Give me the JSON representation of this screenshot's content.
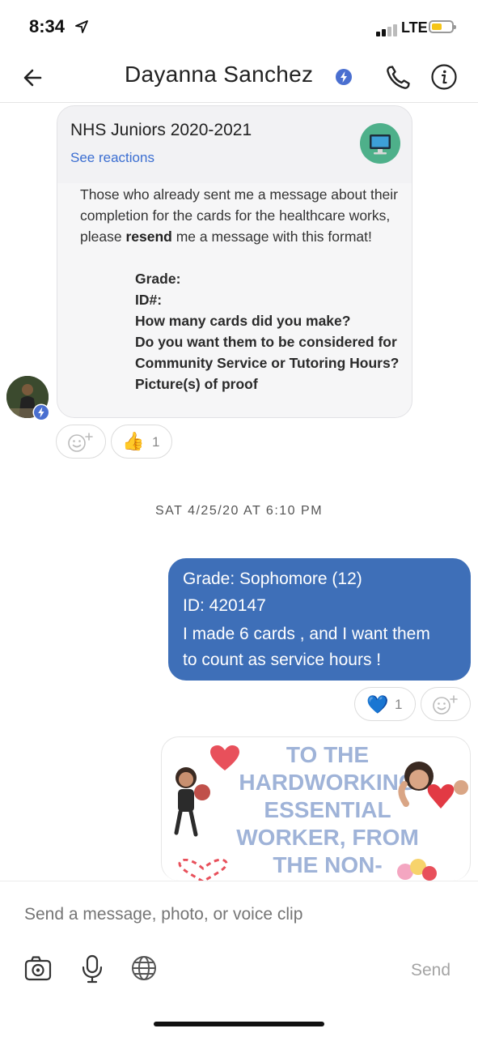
{
  "status_bar": {
    "time": "8:34",
    "network": "LTE"
  },
  "header": {
    "contact_name": "Dayanna Sanchez"
  },
  "post": {
    "title": "NHS Juniors 2020-2021",
    "see_reactions": "See reactions",
    "text_part1": "Those who already sent me a message about their completion for the cards for the healthcare works, please ",
    "text_bold": "resend",
    "text_part2": " me a message with this format!",
    "list": [
      "Grade:",
      "ID#:",
      "How many cards did you make?",
      "Do you want them to be considered for Community Service or Tutoring Hours?",
      "Picture(s) of proof"
    ],
    "reactions": {
      "thumbs_emoji": "👍",
      "thumbs_count": "1"
    }
  },
  "timestamp": "SAT 4/25/20 AT 6:10 PM",
  "outgoing": {
    "lines": [
      "Grade: Sophomore (12)",
      "ID: 420147",
      "I made 6 cards , and I want them",
      "to count as service hours !"
    ],
    "reactions": {
      "heart_emoji": "💙",
      "heart_count": "1"
    }
  },
  "image_message": {
    "lines": [
      "TO THE",
      "HARDWORKING",
      "ESSENTIAL",
      "WORKER, FROM",
      "THE NON-"
    ]
  },
  "composer": {
    "placeholder": "Send a message, photo, or voice clip",
    "send_label": "Send"
  },
  "icons": {
    "back": "arrow-left-icon",
    "verified": "lightning-badge-icon",
    "call": "phone-icon",
    "info": "info-icon",
    "camera": "camera-icon",
    "mic": "microphone-icon",
    "globe": "globe-icon",
    "add_reaction": "smiley-plus-icon"
  },
  "colors": {
    "accent": "#3e6fb8",
    "link": "#3b6ed1",
    "badge": "#4a6fd0",
    "post_icon_bg": "#4eb08a"
  }
}
